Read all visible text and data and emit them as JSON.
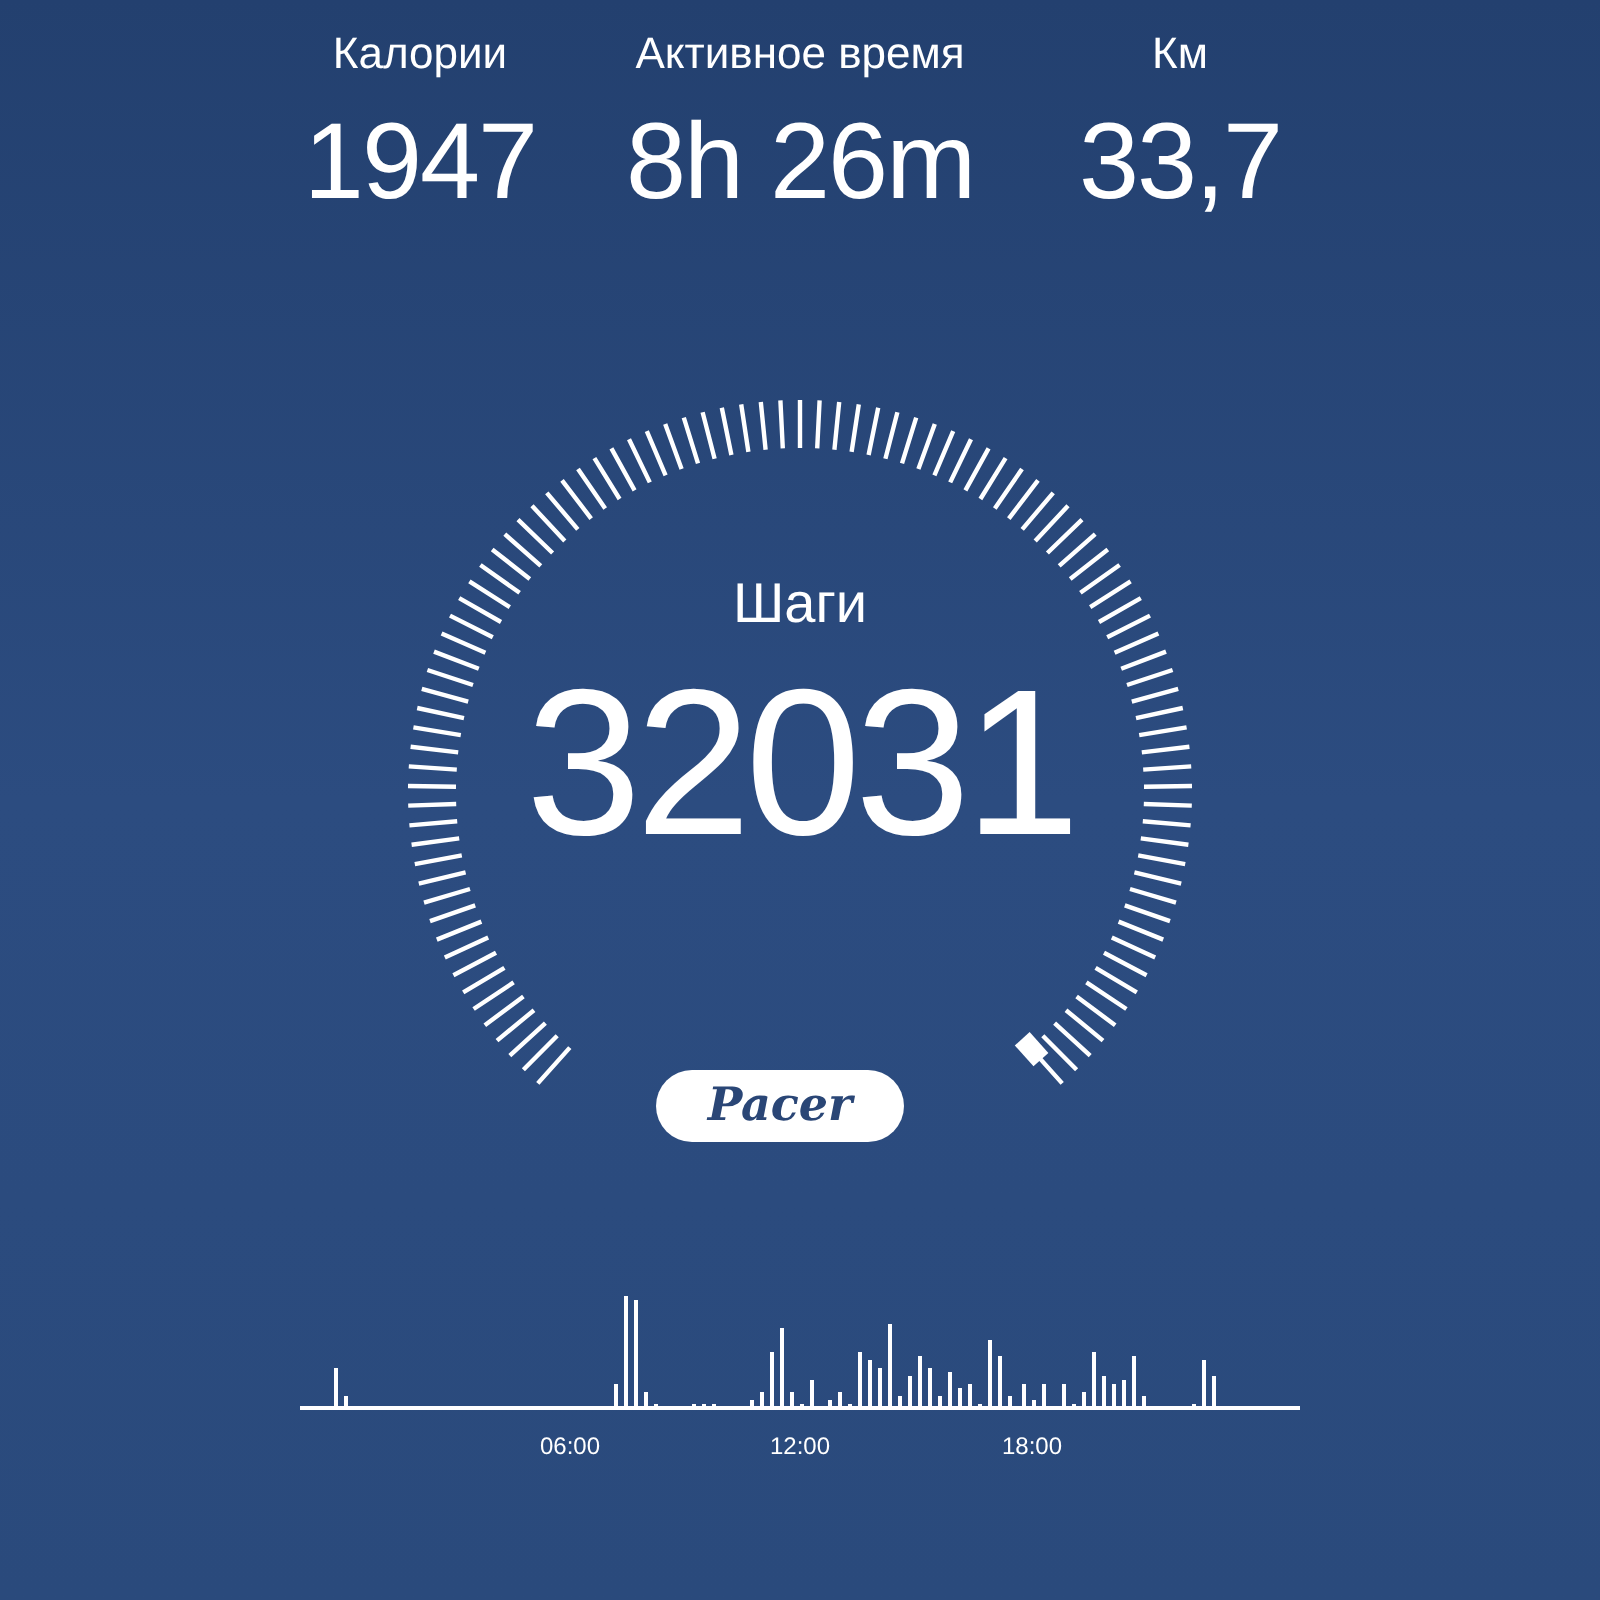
{
  "stats": [
    {
      "label": "Калории",
      "value": "1947"
    },
    {
      "label": "Активное время",
      "value": "8h 26m"
    },
    {
      "label": "Км",
      "value": "33,7"
    }
  ],
  "steps": {
    "label": "Шаги",
    "value": "32031"
  },
  "brand": {
    "text": "Pacer"
  },
  "activity_chart": {
    "axis_labels": [
      "06:00",
      "12:00",
      "18:00"
    ]
  }
}
